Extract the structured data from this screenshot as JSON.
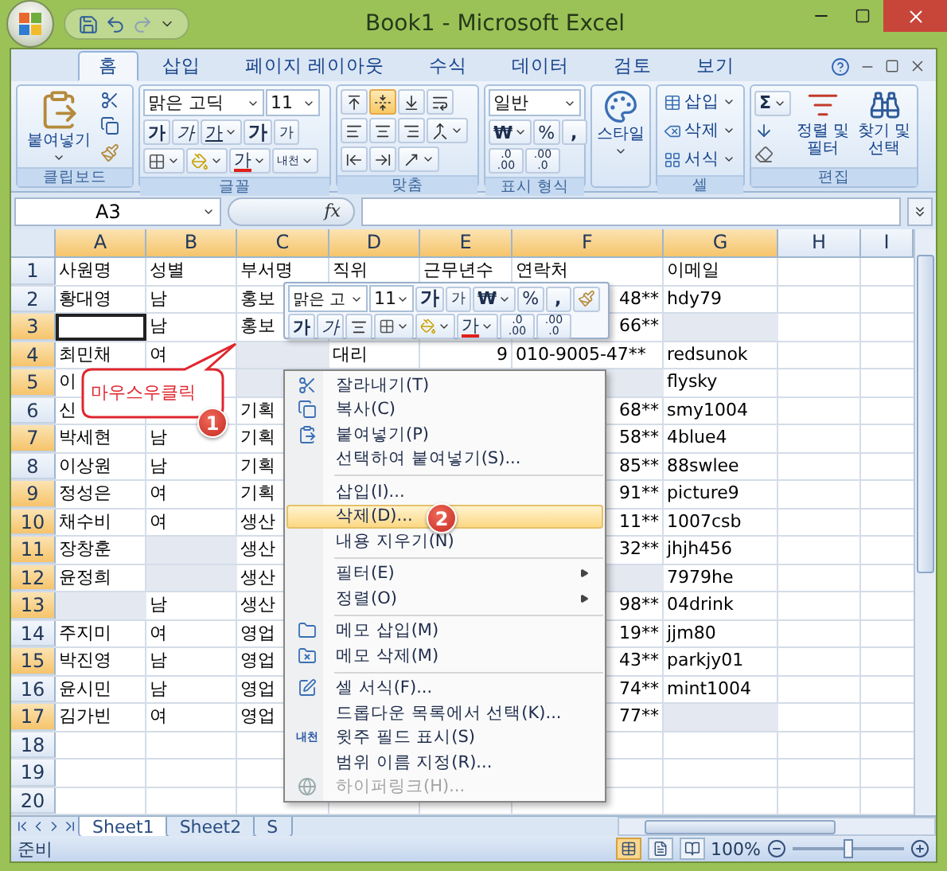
{
  "window": {
    "title": "Book1 - Microsoft Excel"
  },
  "ribbon_tabs": [
    {
      "label": "홈",
      "selected": true
    },
    {
      "label": "삽입",
      "selected": false
    },
    {
      "label": "페이지 레이아웃",
      "selected": false
    },
    {
      "label": "수식",
      "selected": false
    },
    {
      "label": "데이터",
      "selected": false
    },
    {
      "label": "검토",
      "selected": false
    },
    {
      "label": "보기",
      "selected": false
    }
  ],
  "clipboard": {
    "label": "클립보드",
    "paste": "붙여넣기"
  },
  "font": {
    "label": "글꼴",
    "name": "맑은 고딕",
    "size": "11",
    "bold": "가",
    "italic": "가",
    "underline": "가",
    "grow": "가",
    "shrink": "가",
    "font_color": "가",
    "phonetic": "내천"
  },
  "alignment": {
    "label": "맞춤",
    "vertical": [
      {
        "selected": false
      },
      {
        "selected": true
      },
      {
        "selected": false
      }
    ]
  },
  "number": {
    "label": "표시 형식",
    "format": "일반",
    "currency": "₩",
    "percent": "%",
    "comma": ",",
    "decimals": [
      ".0 .00",
      ".00 .0"
    ]
  },
  "styles": {
    "label": "스타일"
  },
  "cells": {
    "label": "셀",
    "buttons": [
      "삽입",
      "삭제",
      "서식"
    ]
  },
  "editing": {
    "label": "편집",
    "sum": "Σ",
    "sort": "정렬 및 필터",
    "find": "찾기 및 선택"
  },
  "formula_bar": {
    "name_box": "A3",
    "fx": "fx"
  },
  "columns": [
    {
      "letter": "A",
      "selected": true
    },
    {
      "letter": "B",
      "selected": true
    },
    {
      "letter": "C",
      "selected": true
    },
    {
      "letter": "D",
      "selected": true
    },
    {
      "letter": "E",
      "selected": true
    },
    {
      "letter": "F",
      "selected": true
    },
    {
      "letter": "G",
      "selected": true
    },
    {
      "letter": "H",
      "selected": false
    },
    {
      "letter": "I",
      "selected": false
    }
  ],
  "rows": [
    {
      "number": "1",
      "selected": false,
      "cells": [
        {
          "kind": "text",
          "text": "사원명"
        },
        {
          "kind": "text",
          "text": "성별"
        },
        {
          "kind": "text",
          "text": "부서명"
        },
        {
          "kind": "text",
          "text": "직위"
        },
        {
          "kind": "text",
          "text": "근무년수"
        },
        {
          "kind": "text",
          "text": "연락처"
        },
        {
          "kind": "text",
          "text": "이메일"
        }
      ]
    },
    {
      "number": "2",
      "selected": false,
      "cells": [
        {
          "kind": "text",
          "text": "황대영"
        },
        {
          "kind": "text",
          "text": "남"
        },
        {
          "kind": "text",
          "text": "홍보"
        },
        {
          "kind": "blank"
        },
        {
          "kind": "blank"
        },
        {
          "kind": "clipped",
          "text": "48**"
        },
        {
          "kind": "text",
          "text": "hdy79"
        }
      ]
    },
    {
      "number": "3",
      "selected": true,
      "cells": [
        {
          "kind": "active"
        },
        {
          "kind": "text",
          "text": "남"
        },
        {
          "kind": "text",
          "text": "홍보"
        },
        {
          "kind": "blank"
        },
        {
          "kind": "blank"
        },
        {
          "kind": "clipped",
          "text": "66**"
        },
        {
          "kind": "selected"
        }
      ]
    },
    {
      "number": "4",
      "selected": true,
      "cells": [
        {
          "kind": "text",
          "text": "최민채"
        },
        {
          "kind": "text",
          "text": "여"
        },
        {
          "kind": "selected"
        },
        {
          "kind": "text",
          "text": "대리"
        },
        {
          "kind": "number",
          "text": "9"
        },
        {
          "kind": "text",
          "text": "010-9005-47**"
        },
        {
          "kind": "text",
          "text": "redsunok"
        }
      ]
    },
    {
      "number": "5",
      "selected": true,
      "cells": [
        {
          "kind": "text",
          "text": "이"
        },
        {
          "kind": "blank"
        },
        {
          "kind": "selected"
        },
        {
          "kind": "blank"
        },
        {
          "kind": "blank"
        },
        {
          "kind": "selected"
        },
        {
          "kind": "text",
          "text": "flysky"
        }
      ]
    },
    {
      "number": "6",
      "selected": false,
      "cells": [
        {
          "kind": "text",
          "text": "신"
        },
        {
          "kind": "blank"
        },
        {
          "kind": "text",
          "text": "기획"
        },
        {
          "kind": "blank"
        },
        {
          "kind": "blank"
        },
        {
          "kind": "clipped",
          "text": "68**"
        },
        {
          "kind": "text",
          "text": "smy1004"
        }
      ]
    },
    {
      "number": "7",
      "selected": true,
      "cells": [
        {
          "kind": "text",
          "text": "박세현"
        },
        {
          "kind": "text",
          "text": "남"
        },
        {
          "kind": "text",
          "text": "기획"
        },
        {
          "kind": "blank"
        },
        {
          "kind": "blank"
        },
        {
          "kind": "clipped",
          "text": "58**"
        },
        {
          "kind": "text",
          "text": "4blue4"
        }
      ]
    },
    {
      "number": "8",
      "selected": false,
      "cells": [
        {
          "kind": "text",
          "text": "이상원"
        },
        {
          "kind": "text",
          "text": "남"
        },
        {
          "kind": "text",
          "text": "기획"
        },
        {
          "kind": "blank"
        },
        {
          "kind": "blank"
        },
        {
          "kind": "clipped",
          "text": "85**"
        },
        {
          "kind": "text",
          "text": "88swlee"
        }
      ]
    },
    {
      "number": "9",
      "selected": true,
      "cells": [
        {
          "kind": "text",
          "text": "정성은"
        },
        {
          "kind": "text",
          "text": "여"
        },
        {
          "kind": "text",
          "text": "기획"
        },
        {
          "kind": "blank"
        },
        {
          "kind": "blank"
        },
        {
          "kind": "clipped",
          "text": "91**"
        },
        {
          "kind": "text",
          "text": "picture9"
        }
      ]
    },
    {
      "number": "10",
      "selected": true,
      "cells": [
        {
          "kind": "text",
          "text": "채수비"
        },
        {
          "kind": "text",
          "text": "여"
        },
        {
          "kind": "text",
          "text": "생산"
        },
        {
          "kind": "blank"
        },
        {
          "kind": "blank"
        },
        {
          "kind": "clipped",
          "text": "11**"
        },
        {
          "kind": "text",
          "text": "1007csb"
        }
      ]
    },
    {
      "number": "11",
      "selected": true,
      "cells": [
        {
          "kind": "text",
          "text": "장창훈"
        },
        {
          "kind": "selected"
        },
        {
          "kind": "text",
          "text": "생산"
        },
        {
          "kind": "blank"
        },
        {
          "kind": "blank"
        },
        {
          "kind": "clipped",
          "text": "32**"
        },
        {
          "kind": "text",
          "text": "jhjh456"
        }
      ]
    },
    {
      "number": "12",
      "selected": true,
      "cells": [
        {
          "kind": "text",
          "text": "윤정희"
        },
        {
          "kind": "selected"
        },
        {
          "kind": "text",
          "text": "생산"
        },
        {
          "kind": "blank"
        },
        {
          "kind": "blank"
        },
        {
          "kind": "selected"
        },
        {
          "kind": "text",
          "text": "7979he"
        }
      ]
    },
    {
      "number": "13",
      "selected": true,
      "cells": [
        {
          "kind": "selected"
        },
        {
          "kind": "text",
          "text": "남"
        },
        {
          "kind": "text",
          "text": "생산"
        },
        {
          "kind": "blank"
        },
        {
          "kind": "blank"
        },
        {
          "kind": "clipped",
          "text": "98**"
        },
        {
          "kind": "text",
          "text": "04drink"
        }
      ]
    },
    {
      "number": "14",
      "selected": false,
      "cells": [
        {
          "kind": "text",
          "text": "주지미"
        },
        {
          "kind": "text",
          "text": "여"
        },
        {
          "kind": "text",
          "text": "영업"
        },
        {
          "kind": "blank"
        },
        {
          "kind": "blank"
        },
        {
          "kind": "clipped",
          "text": "19**"
        },
        {
          "kind": "text",
          "text": "jjm80"
        }
      ]
    },
    {
      "number": "15",
      "selected": true,
      "cells": [
        {
          "kind": "text",
          "text": "박진영"
        },
        {
          "kind": "text",
          "text": "남"
        },
        {
          "kind": "text",
          "text": "영업"
        },
        {
          "kind": "blank"
        },
        {
          "kind": "blank"
        },
        {
          "kind": "clipped",
          "text": "43**"
        },
        {
          "kind": "text",
          "text": "parkjy01"
        }
      ]
    },
    {
      "number": "16",
      "selected": false,
      "cells": [
        {
          "kind": "text",
          "text": "윤시민"
        },
        {
          "kind": "text",
          "text": "남"
        },
        {
          "kind": "text",
          "text": "영업"
        },
        {
          "kind": "blank"
        },
        {
          "kind": "blank"
        },
        {
          "kind": "clipped",
          "text": "74**"
        },
        {
          "kind": "text",
          "text": "mint1004"
        }
      ]
    },
    {
      "number": "17",
      "selected": true,
      "cells": [
        {
          "kind": "text",
          "text": "김가빈"
        },
        {
          "kind": "text",
          "text": "여"
        },
        {
          "kind": "text",
          "text": "영업"
        },
        {
          "kind": "blank"
        },
        {
          "kind": "blank"
        },
        {
          "kind": "clipped",
          "text": "77**"
        },
        {
          "kind": "selected"
        }
      ]
    },
    {
      "number": "18",
      "selected": false
    },
    {
      "number": "19",
      "selected": false
    },
    {
      "number": "20",
      "selected": false
    }
  ],
  "sheet_tabs": [
    {
      "label": "Sheet1",
      "selected": true
    },
    {
      "label": "Sheet2",
      "selected": false
    },
    {
      "label": "S",
      "selected": false
    }
  ],
  "status_bar": {
    "text": "준비",
    "views": [
      {
        "selected": true
      },
      {
        "selected": false
      },
      {
        "selected": false
      }
    ],
    "zoom": "100%",
    "level": 0.5
  },
  "mini_toolbar": {
    "font_name": "맑은 고",
    "size": "11",
    "grow": "가",
    "shrink": "가",
    "currency": "₩",
    "percent": "%",
    "comma": ",",
    "bold": "가",
    "italic": "가",
    "font_color": "가",
    "decimals": [
      ".0 .00",
      ".00 .0"
    ]
  },
  "context_menu": [
    {
      "kind": "item",
      "label": "잘라내기(T)",
      "highlighted": false,
      "disabled": false
    },
    {
      "kind": "item",
      "label": "복사(C)",
      "highlighted": false,
      "disabled": false
    },
    {
      "kind": "item",
      "label": "붙여넣기(P)",
      "highlighted": false,
      "disabled": false
    },
    {
      "kind": "item",
      "label": "선택하여 붙여넣기(S)...",
      "highlighted": false,
      "disabled": false
    },
    {
      "kind": "separator"
    },
    {
      "kind": "item",
      "label": "삽입(I)...",
      "highlighted": false,
      "disabled": false
    },
    {
      "kind": "item",
      "label": "삭제(D)...",
      "highlighted": true,
      "disabled": false
    },
    {
      "kind": "item",
      "label": "내용 지우기(N)",
      "highlighted": false,
      "disabled": false
    },
    {
      "kind": "separator"
    },
    {
      "kind": "submenu",
      "label": "필터(E)",
      "highlighted": false,
      "disabled": false
    },
    {
      "kind": "submenu",
      "label": "정렬(O)",
      "highlighted": false,
      "disabled": false
    },
    {
      "kind": "separator"
    },
    {
      "kind": "item",
      "label": "메모 삽입(M)",
      "highlighted": false,
      "disabled": false
    },
    {
      "kind": "item",
      "label": "메모 삭제(M)",
      "highlighted": false,
      "disabled": false
    },
    {
      "kind": "separator"
    },
    {
      "kind": "item",
      "label": "셀 서식(F)...",
      "highlighted": false,
      "disabled": false
    },
    {
      "kind": "item",
      "label": "드롭다운 목록에서 선택(K)...",
      "highlighted": false,
      "disabled": false
    },
    {
      "kind": "item",
      "label": "윗주 필드 표시(S)",
      "highlighted": false,
      "disabled": false,
      "icon_text": "내천"
    },
    {
      "kind": "item",
      "label": "범위 이름 지정(R)...",
      "highlighted": false,
      "disabled": false
    },
    {
      "kind": "item",
      "label": "하이퍼링크(H)...",
      "highlighted": false,
      "disabled": true
    }
  ],
  "callout": {
    "text": "마우스우클릭"
  },
  "step_badges": [
    "1",
    "2"
  ]
}
